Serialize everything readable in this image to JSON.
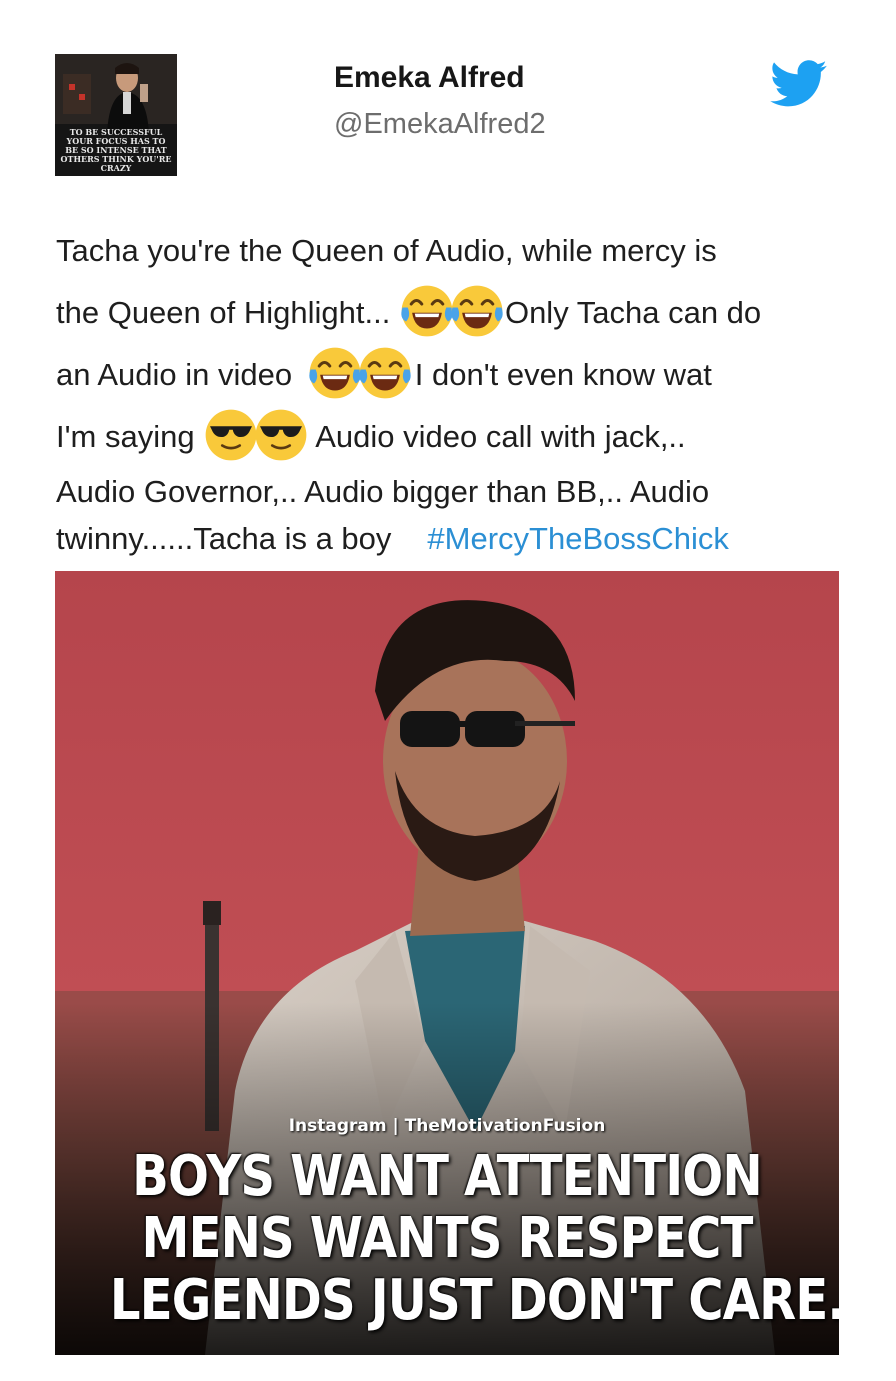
{
  "tweet": {
    "author": {
      "display_name": "Emeka  Alfred",
      "handle": "@EmekaAlfred2",
      "avatar_caption": "TO BE SUCCESSFUL YOUR FOCUS HAS TO BE SO INTENSE THAT OTHERS THINK YOU'RE CRAZY"
    },
    "text_lines": {
      "line1": "Tacha you're the Queen of Audio, while mercy is",
      "line2a": "the Queen of Highlight...",
      "line2b": "Only Tacha can do",
      "line3a": "an Audio in video",
      "line3b": "I don't even know wat",
      "line4a": "I'm saying",
      "line4b": "Audio video call with jack,..",
      "line5": "Audio Governor,.. Audio bigger than BB,.. Audio",
      "line6": "twinny......Tacha is a boy",
      "hashtag": "#MercyTheBossChick"
    },
    "emojis": [
      "face-with-tears-of-joy",
      "smiling-face-with-sunglasses"
    ],
    "image": {
      "credit": "Instagram | TheMotivationFusion",
      "quote_lines": [
        "BOYS WANT ATTENTION",
        "MENS WANTS RESPECT",
        "LEGENDS JUST DON'T CARE."
      ]
    },
    "colors": {
      "hashtag": "#2b8fd4",
      "twitter_blue": "#1da1f2",
      "handle_gray": "#6d6d6d",
      "image_background_red": "#b9474d"
    }
  }
}
